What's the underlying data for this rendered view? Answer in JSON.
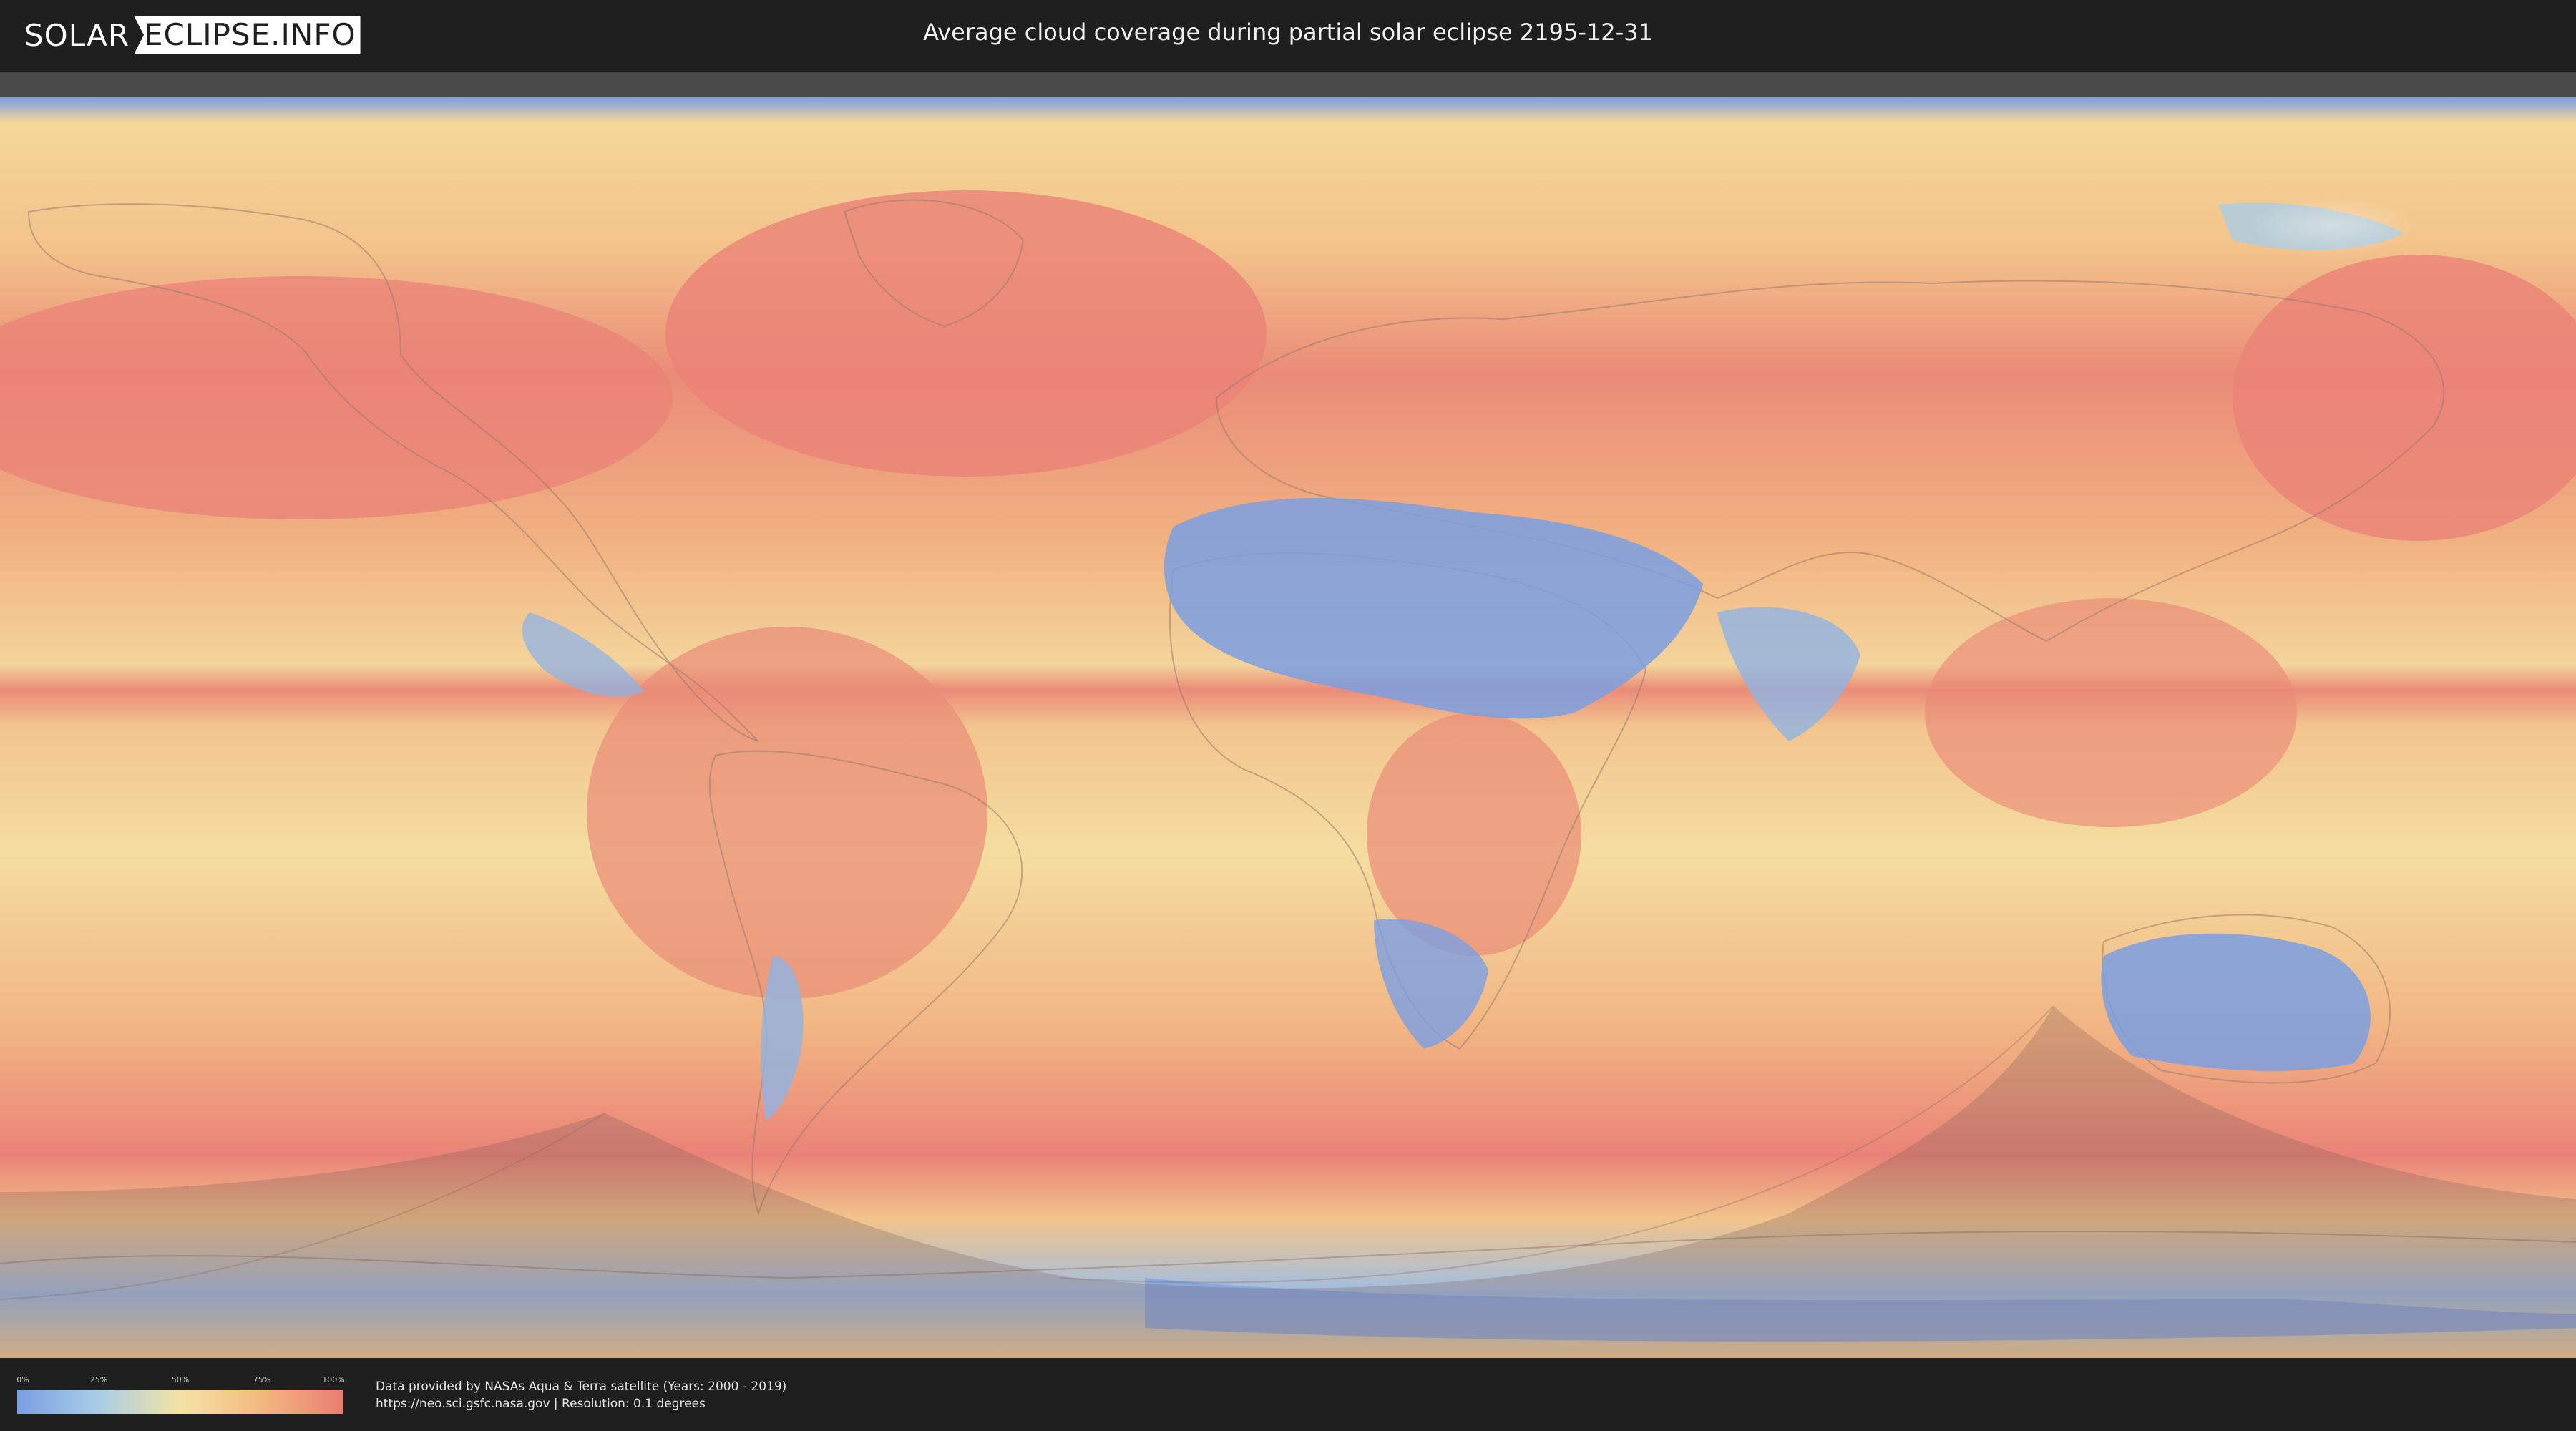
{
  "header": {
    "logo_part1": "SOLAR",
    "logo_part2": "ECLIPSE.INFO",
    "title": "Average cloud coverage during partial solar eclipse 2195-12-31"
  },
  "map": {
    "colors": {
      "clear": "#7a9fe2",
      "low": "#a9cde6",
      "mid": "#f4e3a4",
      "high": "#f3b87f",
      "overcast": "#ea7c72",
      "eclipse_shadow": "#7a5a56"
    }
  },
  "legend": {
    "ticks": [
      "0%",
      "25%",
      "50%",
      "75%",
      "100%"
    ],
    "levels": [
      0,
      0.25,
      0.5,
      0.75,
      1
    ]
  },
  "footer": {
    "line1": "Data provided by NASAs Aqua & Terra satellite (Years: 2000 - 2019)",
    "line2": "https://neo.sci.gsfc.nasa.gov | Resolution: 0.1 degrees"
  }
}
